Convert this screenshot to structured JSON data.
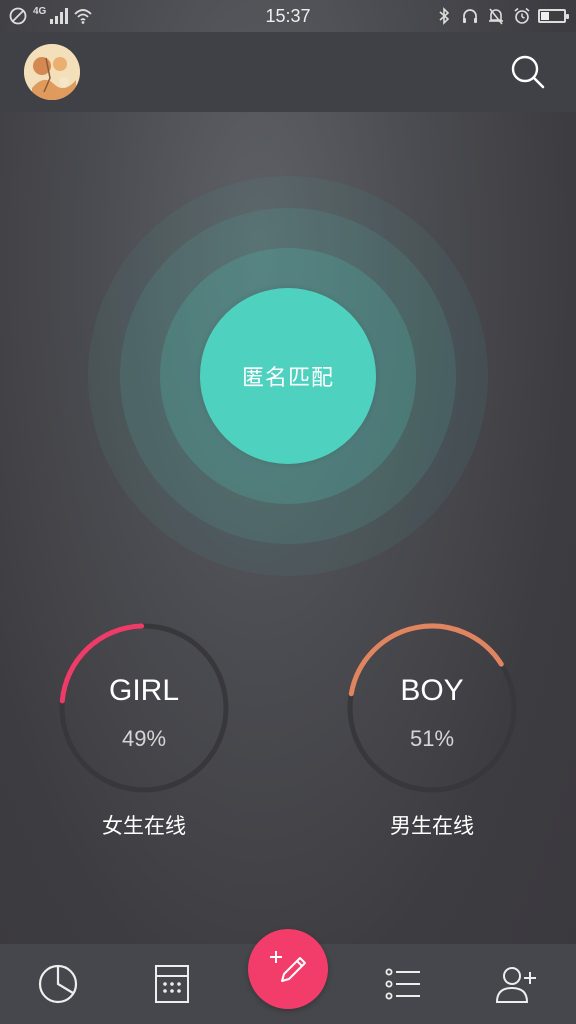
{
  "status_bar": {
    "time": "15:37",
    "network": "4G",
    "icons": [
      "do-not-disturb-icon",
      "signal-icon",
      "wifi-icon",
      "bluetooth-icon",
      "headset-icon",
      "bell-muted-icon",
      "alarm-icon",
      "battery-icon"
    ],
    "battery_level": 0.35
  },
  "header": {
    "avatar_icon": "avatar",
    "search_icon": "search-icon"
  },
  "match": {
    "label": "匿名匹配",
    "color": "#4fd1c0"
  },
  "stats": {
    "girl": {
      "title": "GIRL",
      "percent_text": "49%",
      "percent": 49,
      "caption": "女生在线",
      "color": "#ef3b68"
    },
    "boy": {
      "title": "BOY",
      "percent_text": "51%",
      "percent": 51,
      "caption": "男生在线",
      "color": "#e0855f"
    }
  },
  "bottom_nav": {
    "items": [
      "chart-icon",
      "calendar-icon",
      "compose-icon",
      "list-icon",
      "add-user-icon"
    ],
    "compose_color": "#f23d6a"
  }
}
